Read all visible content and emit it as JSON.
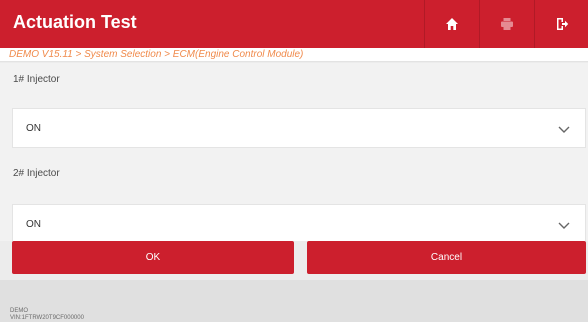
{
  "header": {
    "title": "Actuation Test",
    "icons": {
      "home": "home-icon",
      "print": "print-icon",
      "exit": "exit-icon"
    }
  },
  "breadcrumb": "DEMO V15.11 > System Selection > ECM(Engine Control Module)",
  "fields": [
    {
      "label": "1# Injector",
      "value": "ON"
    },
    {
      "label": "2# Injector",
      "value": "ON"
    }
  ],
  "buttons": {
    "ok": "OK",
    "cancel": "Cancel"
  },
  "footer": {
    "line1": "DEMO",
    "line2": "VIN:1FTRW20T9CF000000"
  },
  "colors": {
    "accent": "#cc1f2d",
    "breadcrumb": "#f08a4b",
    "background": "#f2f2f2"
  }
}
